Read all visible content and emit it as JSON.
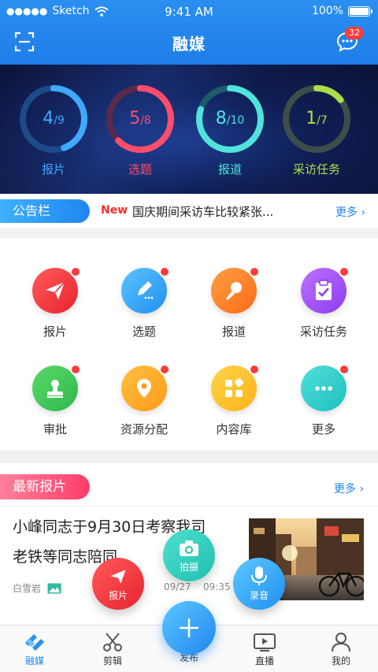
{
  "status_bar": {
    "carrier": "Sketch",
    "time": "9:41 AM",
    "battery": "100%"
  },
  "nav": {
    "title": "融媒",
    "message_badge": "32"
  },
  "stats": [
    {
      "label": "报片",
      "done": "4",
      "total": "/9",
      "progress": 0.444,
      "color": "#3fa9ff",
      "track": "#1d4a8a"
    },
    {
      "label": "选题",
      "done": "5",
      "total": "/8",
      "progress": 0.625,
      "color": "#ff4d6d",
      "track": "#5a2a4a"
    },
    {
      "label": "报道",
      "done": "8",
      "total": "/10",
      "progress": 0.8,
      "color": "#4fe3dc",
      "track": "#1e5a6a"
    },
    {
      "label": "采访任务",
      "done": "1",
      "total": "/7",
      "progress": 0.143,
      "color": "#a8e04a",
      "track": "#3d4e4a"
    }
  ],
  "notice": {
    "tag": "公告栏",
    "new_label": "New",
    "text": "国庆期间采访车比较紧张...",
    "more": "更多 ›"
  },
  "grid": [
    {
      "label": "报片",
      "icon": "paper-plane-icon",
      "color1": "#ff5a5a",
      "color2": "#e8232f"
    },
    {
      "label": "选题",
      "icon": "pencil-icon",
      "color1": "#5cc3ff",
      "color2": "#1f90f0"
    },
    {
      "label": "报道",
      "icon": "microphone-icon",
      "color1": "#ffa040",
      "color2": "#ff6a1a"
    },
    {
      "label": "采访任务",
      "icon": "clipboard-icon",
      "color1": "#c070ff",
      "color2": "#8a3df0"
    },
    {
      "label": "审批",
      "icon": "stamp-icon",
      "color1": "#5bd86b",
      "color2": "#2fb84a"
    },
    {
      "label": "资源分配",
      "icon": "location-icon",
      "color1": "#ffc040",
      "color2": "#ff9a1a"
    },
    {
      "label": "内容库",
      "icon": "apps-icon",
      "color1": "#ffd44a",
      "color2": "#ffb21a"
    },
    {
      "label": "更多",
      "icon": "more-icon",
      "color1": "#4fe0d8",
      "color2": "#1fbfc0"
    }
  ],
  "latest": {
    "tag": "最新报片",
    "more": "更多 ›",
    "title_line1": "小峰同志于9月30日考察我司",
    "title_line2": "老铁等同志陪同",
    "author": "白雪岩",
    "date": "09/27",
    "time": "09:35"
  },
  "fab_menu": {
    "shoot": "拍摄",
    "report": "报片",
    "record": "录音",
    "publish": "发布"
  },
  "tabs": [
    "融媒",
    "剪辑",
    "发布",
    "直播",
    "我的"
  ]
}
